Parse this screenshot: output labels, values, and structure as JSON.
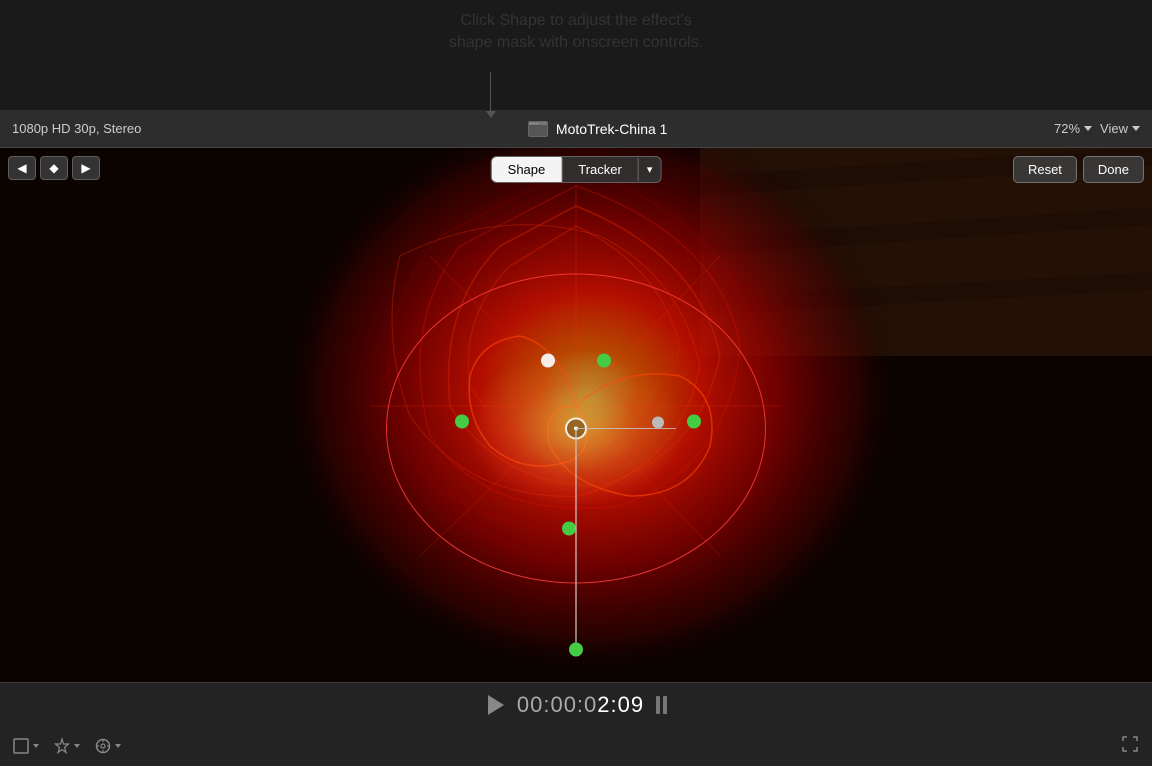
{
  "tooltip": {
    "line1": "Click Shape to adjust the effect's",
    "line2": "shape mask with onscreen controls."
  },
  "topbar": {
    "video_info": "1080p HD 30p, Stereo",
    "clip_title": "MotoTrek-China 1",
    "zoom_level": "72%",
    "view_label": "View"
  },
  "viewer": {
    "shape_btn": "Shape",
    "tracker_btn": "Tracker",
    "reset_btn": "Reset",
    "done_btn": "Done"
  },
  "transport": {
    "timecode_prefix": "00:00:0",
    "timecode_main": "2:09",
    "play_label": "Play"
  },
  "tools": {
    "crop_icon": "⬜",
    "magic_icon": "✦",
    "meter_icon": "◎"
  },
  "nav": {
    "prev_label": "◁",
    "diamond_label": "◇",
    "next_label": "▷"
  }
}
